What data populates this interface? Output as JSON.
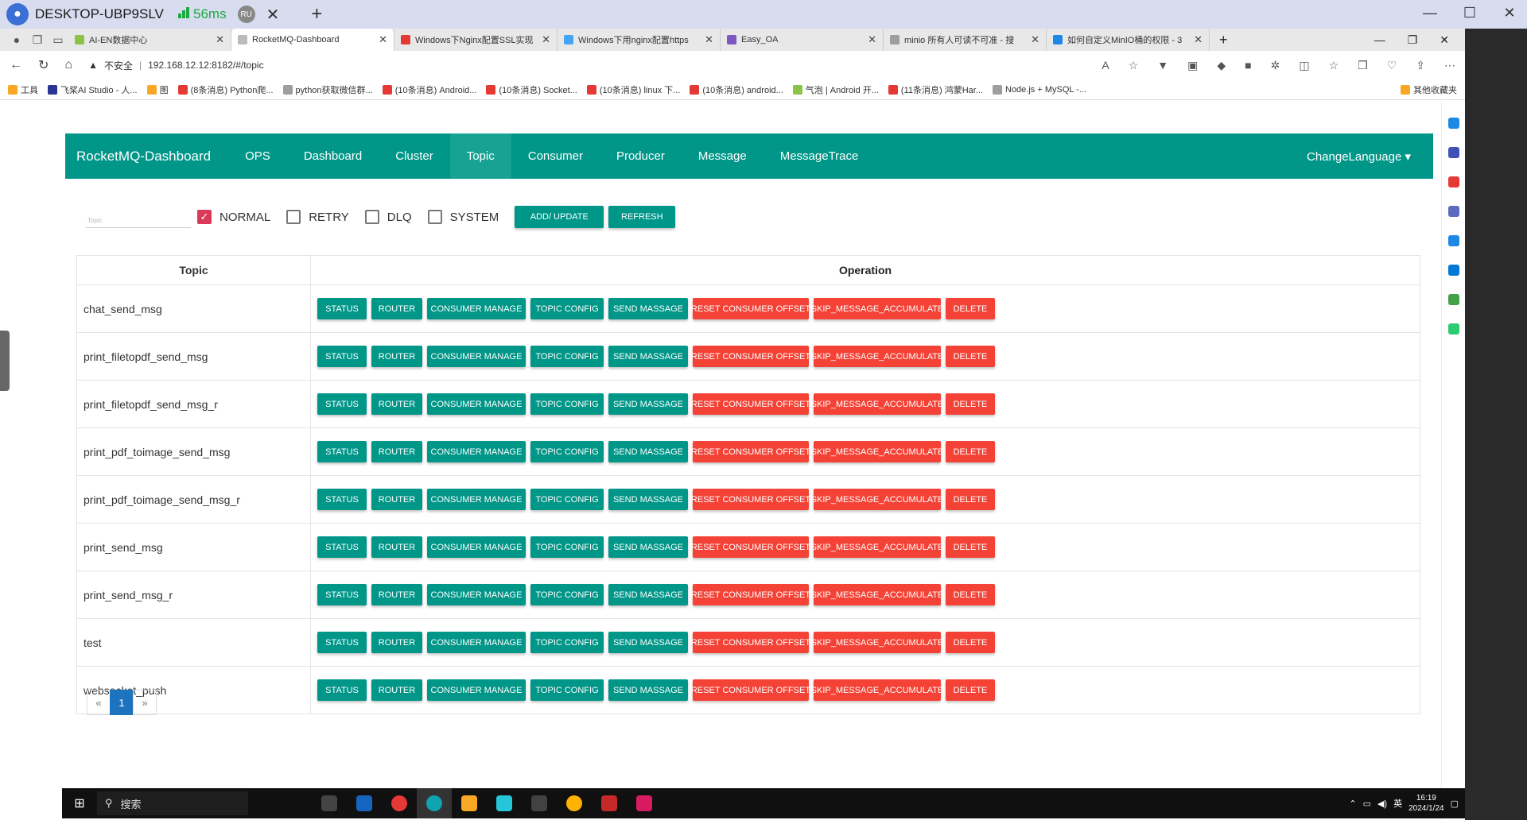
{
  "remote": {
    "title": "DESKTOP-UBP9SLV",
    "latency": "56ms",
    "user_badge": "RU"
  },
  "tabs": [
    {
      "label": "AI-EN数据中心",
      "color": "#8bc34a"
    },
    {
      "label": "RocketMQ-Dashboard",
      "color": "#bbbbbb",
      "active": true
    },
    {
      "label": "Windows下Nginx配置SSL实现",
      "color": "#e53935"
    },
    {
      "label": "Windows下用nginx配置https",
      "color": "#42a5f5"
    },
    {
      "label": "Easy_OA",
      "color": "#7e57c2"
    },
    {
      "label": "minio 所有人可读不可准 - 搜",
      "color": "#9e9e9e"
    },
    {
      "label": "如何自定义MinIO桶的权限 - 3",
      "color": "#1e88e5"
    }
  ],
  "address": {
    "security": "不安全",
    "url": "192.168.12.12:8182/#/topic"
  },
  "bookmarks": [
    "工具",
    "飞桨AI Studio - 人...",
    "图",
    "(8条消息) Python爬...",
    "python获取微信群...",
    "(10条消息) Android...",
    "(10条消息) Socket...",
    "(10条消息) linux 下...",
    "(10条消息) android...",
    "气泡 | Android 开...",
    "(11条消息) 鸿蒙Har...",
    "Node.js + MySQL -...",
    "其他收藏夹"
  ],
  "nav": {
    "brand": "RocketMQ-Dashboard",
    "items": [
      "OPS",
      "Dashboard",
      "Cluster",
      "Topic",
      "Consumer",
      "Producer",
      "Message",
      "MessageTrace"
    ],
    "active": "Topic",
    "language": "ChangeLanguage"
  },
  "filter": {
    "placeholder": "Topic",
    "checkboxes": [
      {
        "label": "NORMAL",
        "checked": true
      },
      {
        "label": "RETRY",
        "checked": false
      },
      {
        "label": "DLQ",
        "checked": false
      },
      {
        "label": "SYSTEM",
        "checked": false
      }
    ],
    "add_update": "ADD/ UPDATE",
    "refresh": "REFRESH"
  },
  "table": {
    "headers": [
      "Topic",
      "Operation"
    ],
    "operations": [
      {
        "label": "STATUS",
        "color": "green"
      },
      {
        "label": "ROUTER",
        "color": "green"
      },
      {
        "label": "CONSUMER MANAGE",
        "color": "green"
      },
      {
        "label": "TOPIC CONFIG",
        "color": "green"
      },
      {
        "label": "SEND MASSAGE",
        "color": "green"
      },
      {
        "label": "RESET CONSUMER OFFSET",
        "color": "red"
      },
      {
        "label": "SKIP_MESSAGE_ACCUMULATE",
        "color": "red"
      },
      {
        "label": "DELETE",
        "color": "red"
      }
    ],
    "rows": [
      "chat_send_msg",
      "print_filetopdf_send_msg",
      "print_filetopdf_send_msg_r",
      "print_pdf_toimage_send_msg",
      "print_pdf_toimage_send_msg_r",
      "print_send_msg",
      "print_send_msg_r",
      "test",
      "websocket_push"
    ]
  },
  "pager": {
    "prev": "«",
    "current": "1",
    "next": "»"
  },
  "taskbar": {
    "search": "搜索",
    "ime": "英",
    "time": "16:19",
    "date": "2024/1/24"
  }
}
